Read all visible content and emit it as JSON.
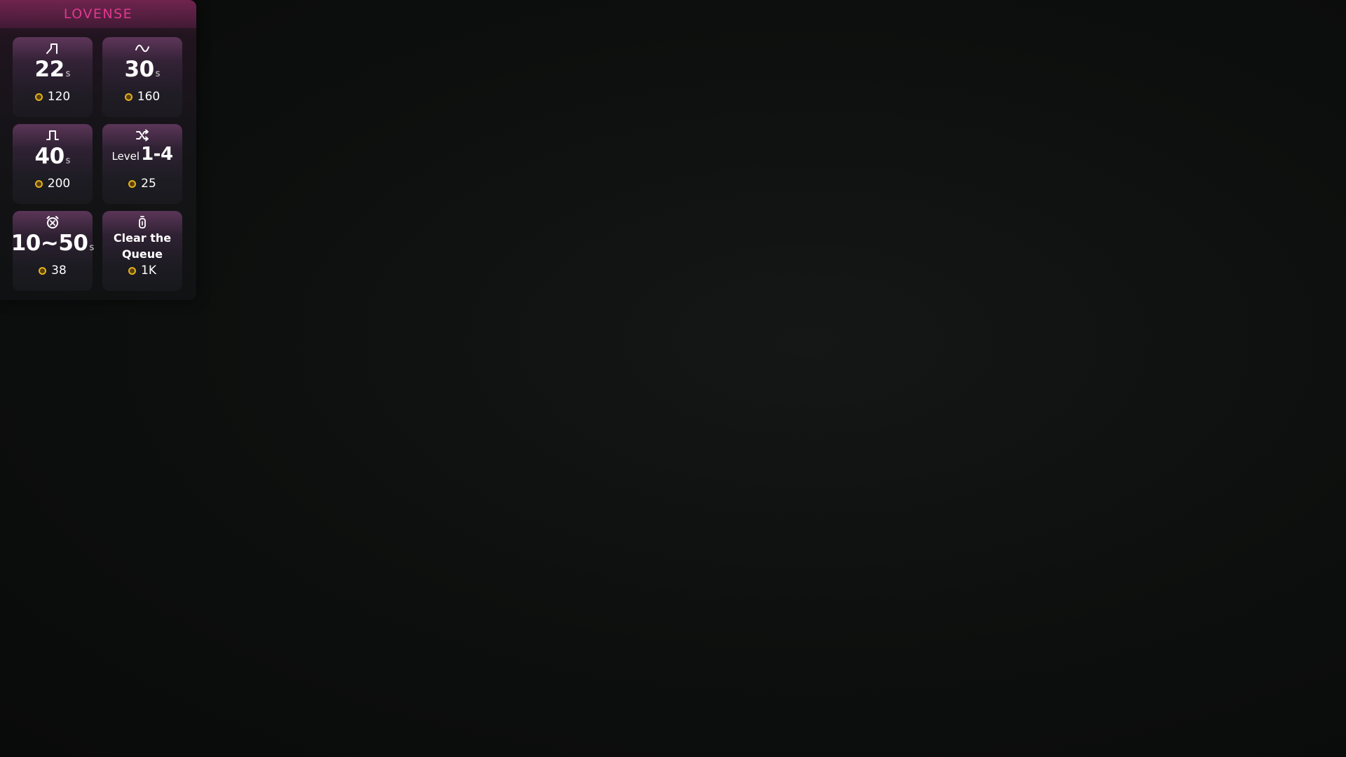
{
  "brand": {
    "logo_text": "LOVENSE",
    "accent_color": "#e0388f",
    "coin_color": "#e5b21f"
  },
  "tiles": [
    {
      "icon": "step-wave-icon",
      "value": "22",
      "unit": "s",
      "price": "120"
    },
    {
      "icon": "sine-wave-icon",
      "value": "30",
      "unit": "s",
      "price": "160"
    },
    {
      "icon": "pulse-wave-icon",
      "value": "40",
      "unit": "s",
      "price": "200"
    },
    {
      "icon": "shuffle-icon",
      "prefix": "Level",
      "value": "1-4",
      "price": "25"
    },
    {
      "icon": "alarm-clock-icon",
      "value": "10~50",
      "unit": "s",
      "price": "38"
    },
    {
      "icon": "toy-icon",
      "line1": "Clear the",
      "line2": "Queue",
      "price": "1K"
    }
  ]
}
